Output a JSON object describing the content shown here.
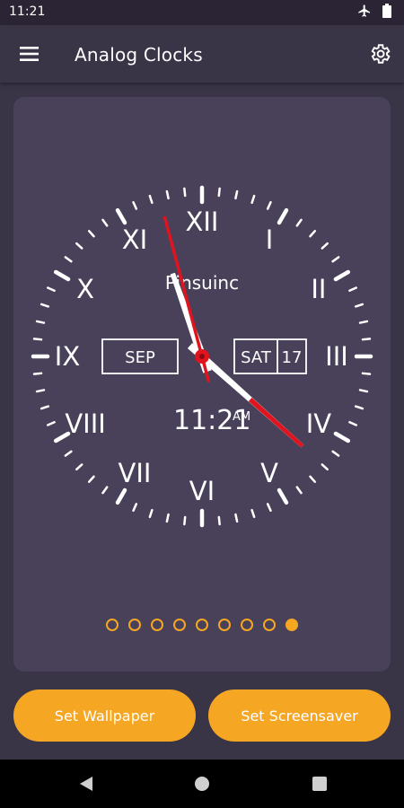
{
  "status_bar": {
    "time": "11:21",
    "icons": [
      "airplane-mode-icon",
      "battery-icon"
    ]
  },
  "app_bar": {
    "title": "Analog Clocks",
    "menu_icon": "hamburger-menu-icon",
    "settings_icon": "gear-icon"
  },
  "clock": {
    "brand": "Pinsuinc",
    "month": "SEP",
    "weekday": "SAT",
    "day": "17",
    "digital_time": "11:21",
    "ampm": "AM",
    "numerals": [
      "XII",
      "I",
      "II",
      "III",
      "IV",
      "V",
      "VI",
      "VII",
      "VIII",
      "IX",
      "X",
      "XI"
    ],
    "time": {
      "hours": 11,
      "minutes": 21,
      "seconds": 57.5
    },
    "colors": {
      "face": "#494159",
      "markings": "#ffffff",
      "second_hand": "#e0141e"
    }
  },
  "pager": {
    "total": 9,
    "active_index": 8,
    "color": "#f5a623"
  },
  "buttons": {
    "set_wallpaper": "Set Wallpaper",
    "set_screensaver": "Set Screensaver"
  },
  "nav_bar": {
    "icons": [
      "back-icon",
      "home-icon",
      "recent-apps-icon"
    ]
  }
}
